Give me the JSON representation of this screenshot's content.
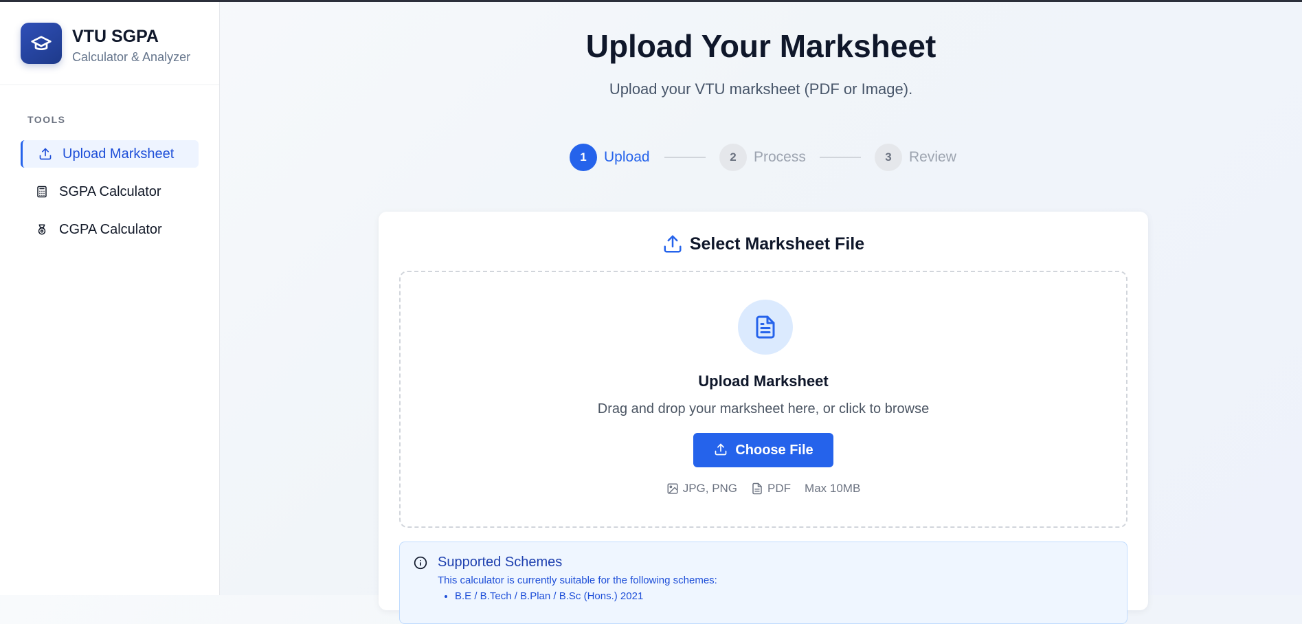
{
  "brand": {
    "title": "VTU SGPA",
    "subtitle": "Calculator & Analyzer"
  },
  "sidebar": {
    "section_label": "TOOLS",
    "items": [
      {
        "label": "Upload Marksheet",
        "icon": "upload-icon",
        "active": true
      },
      {
        "label": "SGPA Calculator",
        "icon": "calculator-icon",
        "active": false
      },
      {
        "label": "CGPA Calculator",
        "icon": "award-icon",
        "active": false
      }
    ]
  },
  "header": {
    "title": "Upload Your Marksheet",
    "subtitle": "Upload your VTU marksheet (PDF or Image)."
  },
  "stepper": [
    {
      "number": "1",
      "label": "Upload",
      "state": "active"
    },
    {
      "number": "2",
      "label": "Process",
      "state": "inactive"
    },
    {
      "number": "3",
      "label": "Review",
      "state": "inactive"
    }
  ],
  "card": {
    "title": "Select Marksheet File",
    "dropzone": {
      "title": "Upload Marksheet",
      "subtitle": "Drag and drop your marksheet here, or click to browse",
      "button_label": "Choose File",
      "formats": {
        "image": "JPG, PNG",
        "pdf": "PDF",
        "max_size": "Max 10MB"
      }
    },
    "info": {
      "title": "Supported Schemes",
      "text": "This calculator is currently suitable for the following schemes:",
      "items": [
        "B.E / B.Tech / B.Plan / B.Sc (Hons.) 2021"
      ]
    }
  },
  "colors": {
    "accent": "#2563eb",
    "brand_dark": "#1e3a8a",
    "info_bg": "#eff6ff"
  }
}
